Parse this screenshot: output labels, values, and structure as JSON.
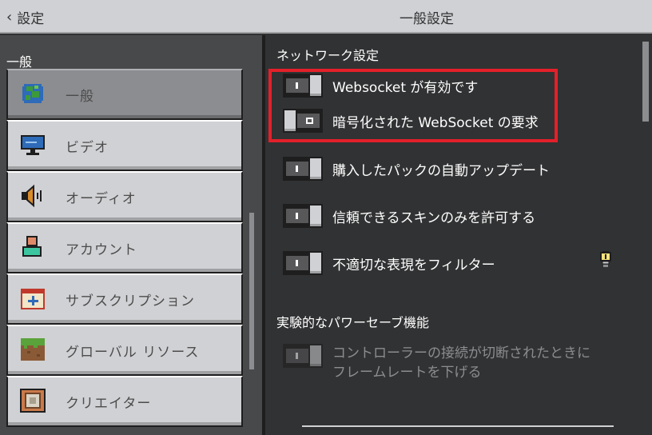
{
  "header": {
    "back_label": "設定",
    "title": "一般設定"
  },
  "sidebar": {
    "heading": "一般",
    "items": [
      {
        "label": "一般",
        "icon": "globe-icon",
        "selected": true
      },
      {
        "label": "ビデオ",
        "icon": "monitor-icon",
        "selected": false
      },
      {
        "label": "オーディオ",
        "icon": "speaker-icon",
        "selected": false
      },
      {
        "label": "アカウント",
        "icon": "account-icon",
        "selected": false
      },
      {
        "label": "サブスクリプション",
        "icon": "subscription-icon",
        "selected": false
      },
      {
        "label": "グローバル リソース",
        "icon": "grass-block-icon",
        "selected": false
      },
      {
        "label": "クリエイター",
        "icon": "command-block-icon",
        "selected": false
      }
    ]
  },
  "content": {
    "network_section_title": "ネットワーク設定",
    "settings": [
      {
        "label": "Websocket が有効です",
        "on": true,
        "enabled": true
      },
      {
        "label": "暗号化された WebSocket の要求",
        "on": false,
        "enabled": true
      },
      {
        "label": "購入したパックの自動アップデート",
        "on": true,
        "enabled": true
      },
      {
        "label": "信頼できるスキンのみを許可する",
        "on": true,
        "enabled": true
      },
      {
        "label": "不適切な表現をフィルター",
        "on": true,
        "enabled": true
      }
    ],
    "experimental_section_title": "実験的なパワーセーブ機能",
    "experimental_setting": {
      "label_line1": "コントローラーの接続が切断されたときに",
      "label_line2": "フレームレートを下げる",
      "on": true,
      "enabled": false
    }
  },
  "colors": {
    "highlight_box": "#e3202a",
    "background": "#313233",
    "button": "#d0d1d4"
  }
}
